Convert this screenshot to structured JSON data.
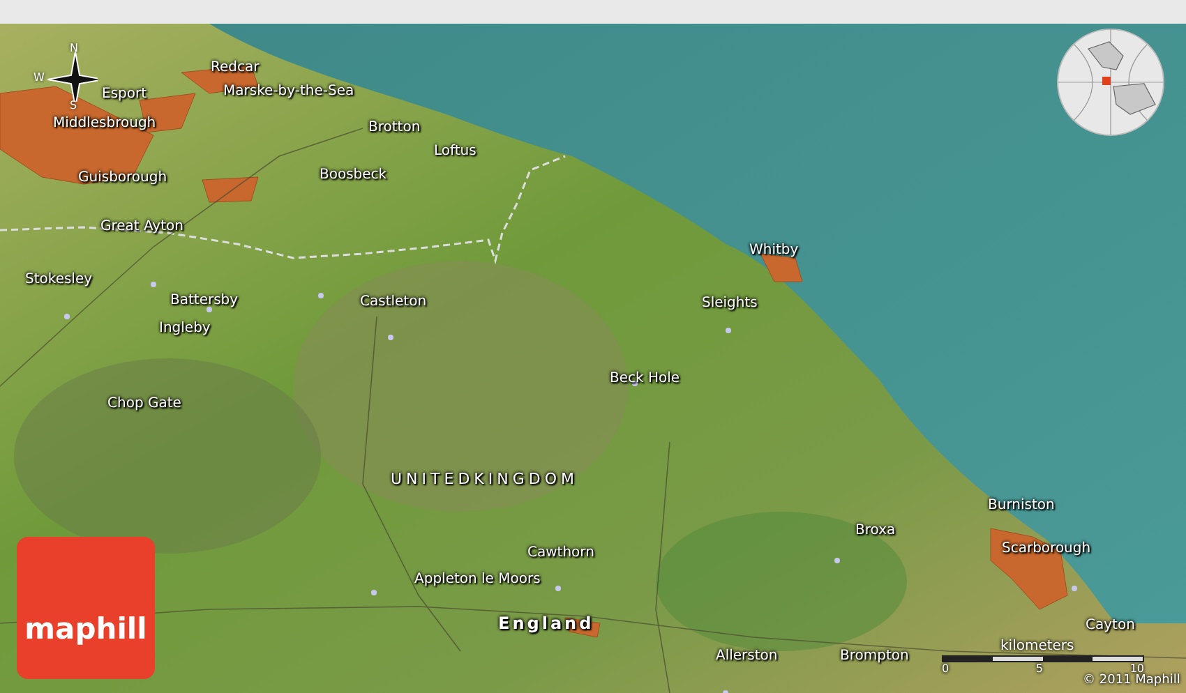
{
  "map": {
    "places": [
      {
        "name": "Redcar",
        "kind": "place"
      },
      {
        "name": "Esport",
        "kind": "place"
      },
      {
        "name": "Marske-by-the-Sea",
        "kind": "place"
      },
      {
        "name": "Middlesbrough",
        "kind": "place"
      },
      {
        "name": "Brotton",
        "kind": "place"
      },
      {
        "name": "Loftus",
        "kind": "place"
      },
      {
        "name": "Guisborough",
        "kind": "place"
      },
      {
        "name": "Boosbeck",
        "kind": "place"
      },
      {
        "name": "Great Ayton",
        "kind": "place"
      },
      {
        "name": "Whitby",
        "kind": "place"
      },
      {
        "name": "Stokesley",
        "kind": "place"
      },
      {
        "name": "Battersby",
        "kind": "place"
      },
      {
        "name": "Castleton",
        "kind": "place"
      },
      {
        "name": "Sleights",
        "kind": "place"
      },
      {
        "name": "Ingleby",
        "kind": "place"
      },
      {
        "name": "Beck Hole",
        "kind": "place"
      },
      {
        "name": "Chop Gate",
        "kind": "place"
      },
      {
        "name": "UNITEDKINGDOM",
        "kind": "country"
      },
      {
        "name": "Burniston",
        "kind": "place"
      },
      {
        "name": "Broxa",
        "kind": "place"
      },
      {
        "name": "Cawthorn",
        "kind": "place"
      },
      {
        "name": "Scarborough",
        "kind": "place"
      },
      {
        "name": "Appleton le Moors",
        "kind": "place"
      },
      {
        "name": "England",
        "kind": "region"
      },
      {
        "name": "Cayton",
        "kind": "place"
      },
      {
        "name": "Allerston",
        "kind": "place"
      },
      {
        "name": "Brompton",
        "kind": "place"
      }
    ],
    "compass": {
      "north": "N",
      "west": "W",
      "south": "S"
    },
    "scale": {
      "unit": "kilometers",
      "ticks": [
        "0",
        "5",
        "10"
      ]
    },
    "copyright": "© 2011 Maphill",
    "logo": "maphill"
  }
}
